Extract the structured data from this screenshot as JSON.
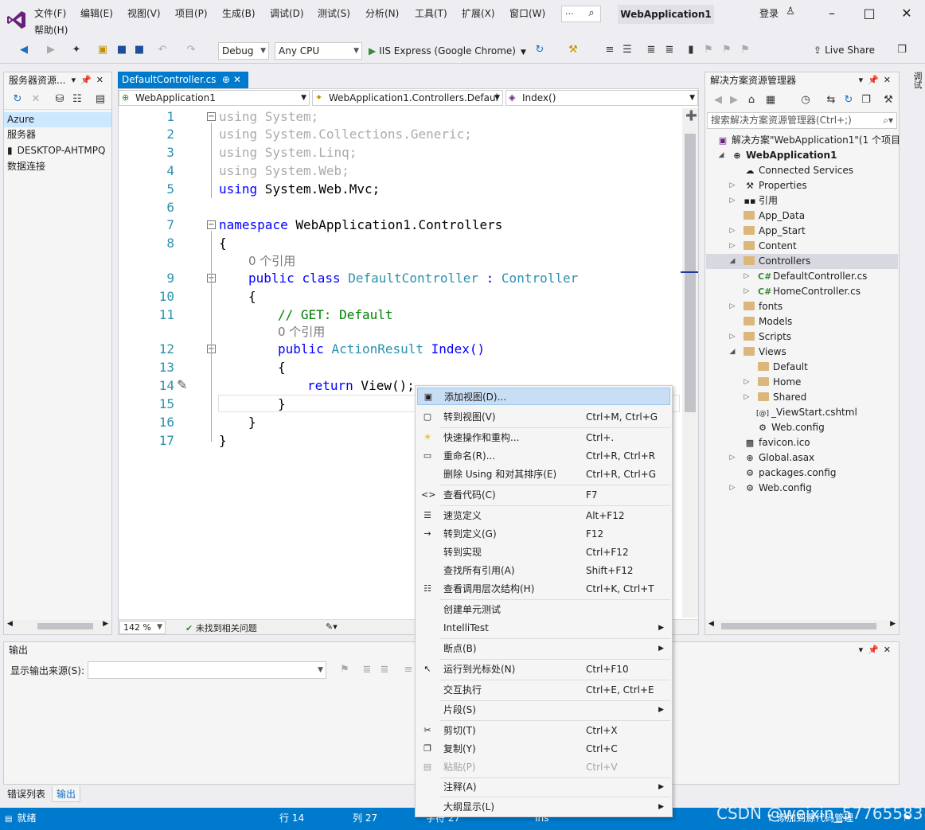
{
  "menu": {
    "items": [
      "文件(F)",
      "编辑(E)",
      "视图(V)",
      "项目(P)",
      "生成(B)",
      "调试(D)",
      "测试(S)",
      "分析(N)",
      "工具(T)",
      "扩展(X)",
      "窗口(W)",
      "帮助(H)"
    ],
    "search_dots": "...",
    "solution_name": "WebApplication1",
    "login": "登录"
  },
  "toolbar": {
    "config": "Debug",
    "platform": "Any CPU",
    "run": "IIS Express (Google Chrome)",
    "liveshare": "Live Share"
  },
  "server_explorer": {
    "title": "服务器资源...",
    "items": [
      "Azure",
      "服务器",
      "DESKTOP-AHTMPQ",
      "数据连接"
    ]
  },
  "editor": {
    "tab": "DefaultController.cs",
    "nav_project": "WebApplication1",
    "nav_class": "WebApplication1.Controllers.Defaul",
    "nav_member": "Index()",
    "zoom": "142 %",
    "issues": "未找到相关问题",
    "lines": [
      {
        "n": "1",
        "t": "using System;"
      },
      {
        "n": "2",
        "t": "using System.Collections.Generic;"
      },
      {
        "n": "3",
        "t": "using System.Linq;"
      },
      {
        "n": "4",
        "t": "using System.Web;"
      },
      {
        "n": "5",
        "t": "using System.Web.Mvc;"
      },
      {
        "n": "6",
        "t": ""
      },
      {
        "n": "7",
        "t": "namespace WebApplication1.Controllers"
      },
      {
        "n": "8",
        "t": "{"
      },
      {
        "n": "9",
        "t": "public class DefaultController : Controller"
      },
      {
        "n": "10",
        "t": "{"
      },
      {
        "n": "11",
        "t": "// GET: Default"
      },
      {
        "n": "12",
        "t": "public ActionResult Index()"
      },
      {
        "n": "13",
        "t": "{"
      },
      {
        "n": "14",
        "t": "return View();"
      },
      {
        "n": "15",
        "t": "}"
      },
      {
        "n": "16",
        "t": "}"
      },
      {
        "n": "17",
        "t": "}"
      }
    ],
    "ref_count": "0 个引用"
  },
  "solution_explorer": {
    "title": "解决方案资源管理器",
    "search_placeholder": "搜索解决方案资源管理器(Ctrl+;)",
    "rows": [
      "解决方案\"WebApplication1\"(1 个项目",
      "WebApplication1",
      "Connected Services",
      "Properties",
      "引用",
      "App_Data",
      "App_Start",
      "Content",
      "Controllers",
      "DefaultController.cs",
      "HomeController.cs",
      "fonts",
      "Models",
      "Scripts",
      "Views",
      "Default",
      "Home",
      "Shared",
      "_ViewStart.cshtml",
      "Web.config",
      "favicon.ico",
      "Global.asax",
      "packages.config",
      "Web.config"
    ]
  },
  "side_strip": "调试",
  "output": {
    "title": "输出",
    "source_label": "显示输出来源(S):"
  },
  "bottom_tabs": [
    "错误列表",
    "输出"
  ],
  "statusbar": {
    "ready": "就绪",
    "line": "行 14",
    "col": "列 27",
    "ch": "字符 27",
    "ins": "Ins",
    "source_control": "添加到源代码管理"
  },
  "watermark": "CSDN @weixin_57765583",
  "context_menu": [
    {
      "label": "添加视图(D)...",
      "shortcut": "",
      "icon": "add-view-icon",
      "highlight": true
    },
    {
      "label": "转到视图(V)",
      "shortcut": "Ctrl+M, Ctrl+G",
      "icon": "goto-view-icon"
    },
    {
      "label": "快速操作和重构...",
      "shortcut": "Ctrl+.",
      "icon": "lightbulb-icon"
    },
    {
      "label": "重命名(R)...",
      "shortcut": "Ctrl+R, Ctrl+R",
      "icon": "rename-icon"
    },
    {
      "label": "删除 Using 和对其排序(E)",
      "shortcut": "Ctrl+R, Ctrl+G",
      "icon": ""
    },
    {
      "label": "查看代码(C)",
      "shortcut": "F7",
      "icon": "code-icon"
    },
    {
      "label": "速览定义",
      "shortcut": "Alt+F12",
      "icon": "peek-icon"
    },
    {
      "label": "转到定义(G)",
      "shortcut": "F12",
      "icon": "goto-def-icon"
    },
    {
      "label": "转到实现",
      "shortcut": "Ctrl+F12",
      "icon": ""
    },
    {
      "label": "查找所有引用(A)",
      "shortcut": "Shift+F12",
      "icon": ""
    },
    {
      "label": "查看调用层次结构(H)",
      "shortcut": "Ctrl+K, Ctrl+T",
      "icon": "call-hierarchy-icon"
    },
    {
      "label": "创建单元测试",
      "shortcut": "",
      "icon": ""
    },
    {
      "label": "IntelliTest",
      "shortcut": "",
      "icon": "",
      "submenu": true
    },
    {
      "label": "断点(B)",
      "shortcut": "",
      "icon": "",
      "submenu": true
    },
    {
      "label": "运行到光标处(N)",
      "shortcut": "Ctrl+F10",
      "icon": "cursor-icon"
    },
    {
      "label": "交互执行",
      "shortcut": "Ctrl+E, Ctrl+E",
      "icon": ""
    },
    {
      "label": "片段(S)",
      "shortcut": "",
      "icon": "",
      "submenu": true
    },
    {
      "label": "剪切(T)",
      "shortcut": "Ctrl+X",
      "icon": "scissors-icon"
    },
    {
      "label": "复制(Y)",
      "shortcut": "Ctrl+C",
      "icon": "copy-icon"
    },
    {
      "label": "粘贴(P)",
      "shortcut": "Ctrl+V",
      "icon": "paste-icon",
      "disabled": true
    },
    {
      "label": "注释(A)",
      "shortcut": "",
      "icon": "",
      "submenu": true
    },
    {
      "label": "大纲显示(L)",
      "shortcut": "",
      "icon": "",
      "submenu": true
    }
  ]
}
